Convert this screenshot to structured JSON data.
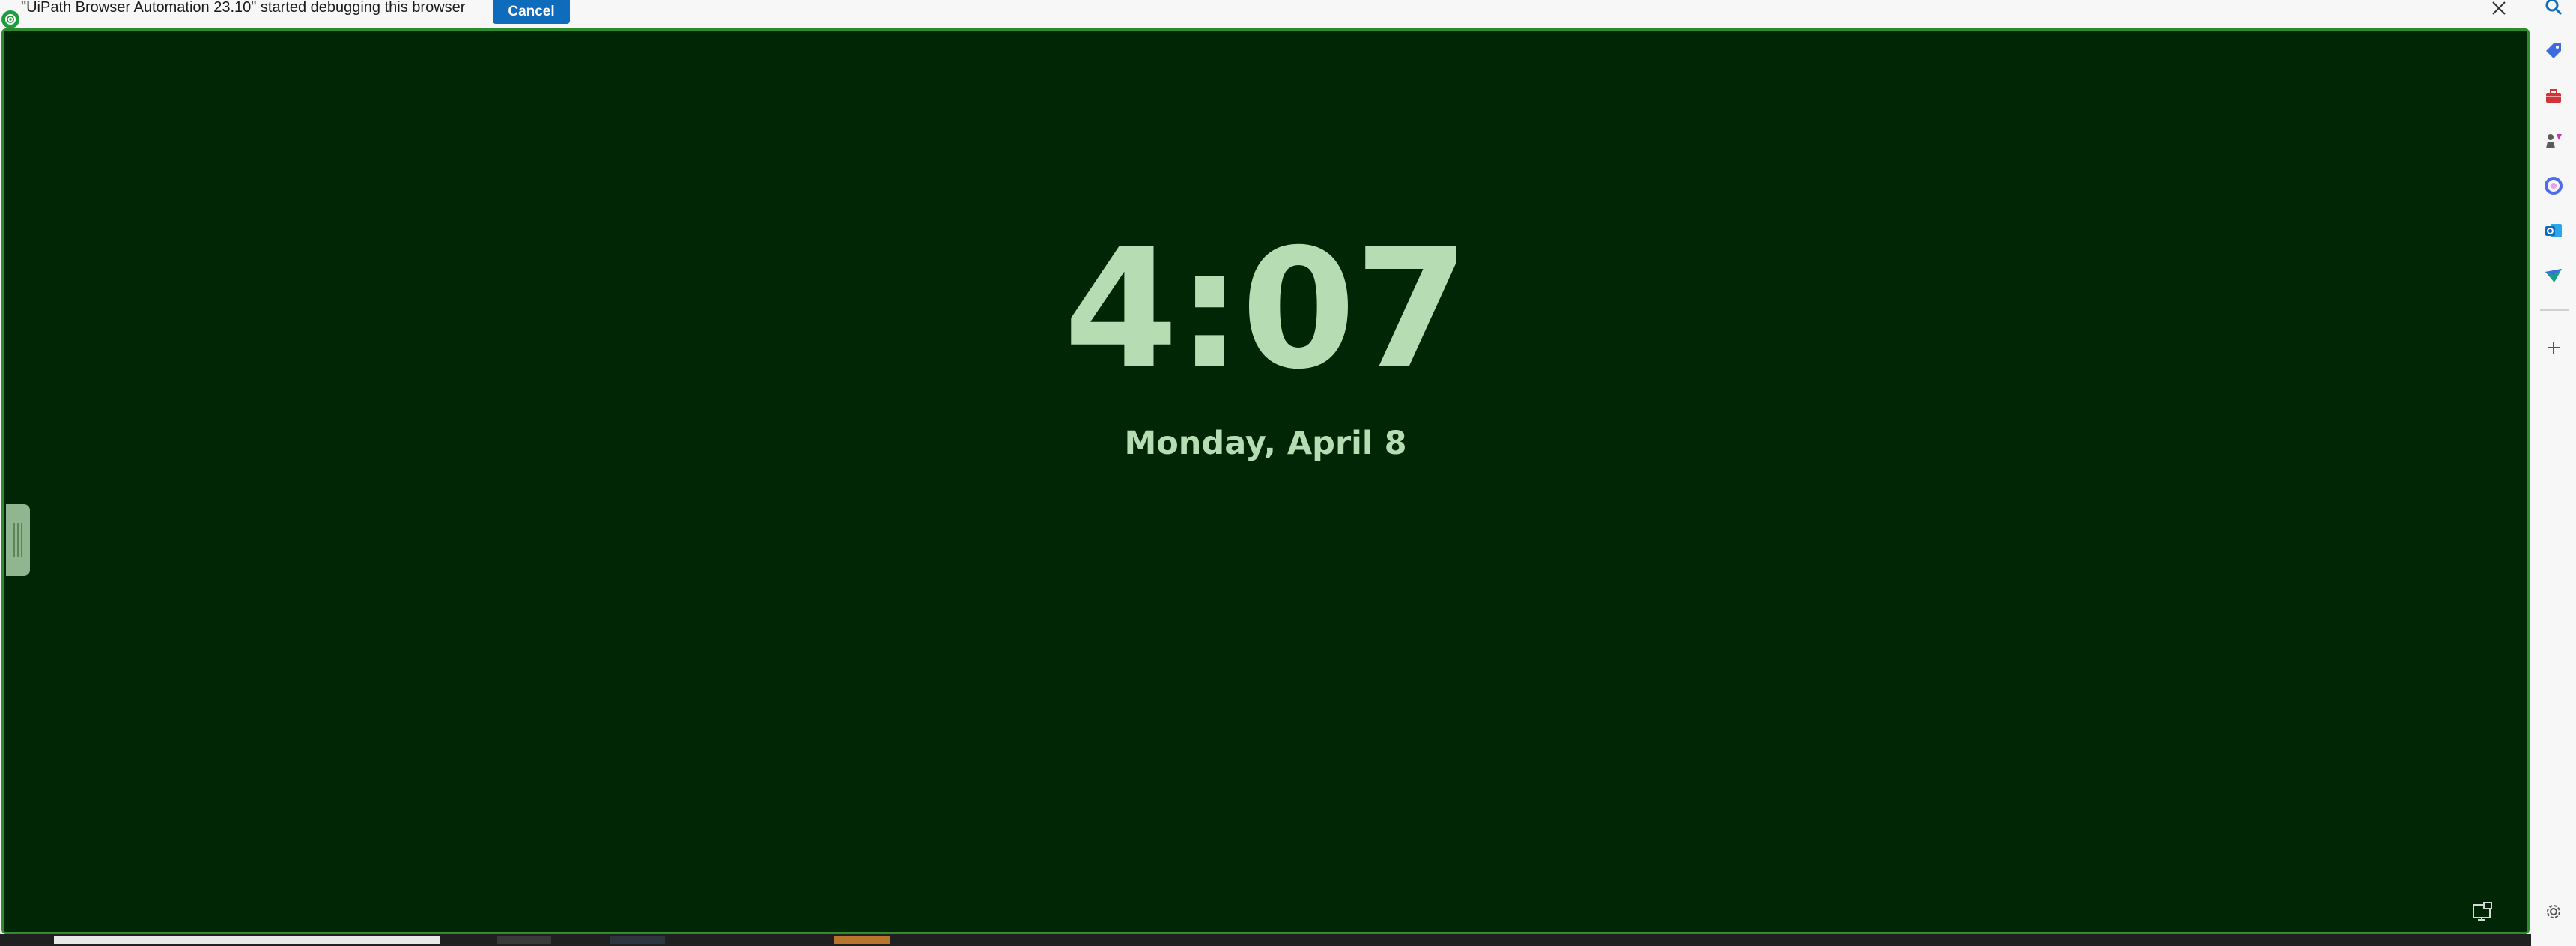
{
  "infobar": {
    "message": "\"UiPath Browser Automation 23.10\" started debugging this browser",
    "cancel_label": "Cancel",
    "icon": "uipath-icon",
    "close_icon": "close-icon"
  },
  "lockscreen": {
    "time": "4:07",
    "date": "Monday, April 8",
    "handle_icon": "drag-handle-icon",
    "pip_icon": "picture-in-picture-icon"
  },
  "sidebar": {
    "items": [
      {
        "name": "search-icon",
        "color": "#0f6cbd"
      },
      {
        "name": "shopping-tag-icon",
        "color": "#3b6de0"
      },
      {
        "name": "tools-icon",
        "color": "#d13438"
      },
      {
        "name": "games-icon",
        "color": "#5b5b5b"
      },
      {
        "name": "copilot-icon",
        "color": "#4f6bed"
      },
      {
        "name": "outlook-icon",
        "color": "#0f6cbd"
      },
      {
        "name": "drop-icon",
        "color": "#16a085"
      },
      {
        "name": "add-icon",
        "color": "#555555"
      },
      {
        "name": "settings-icon",
        "color": "#555555"
      }
    ]
  },
  "colors": {
    "background": "#002605",
    "border": "#2e8b2e",
    "clock_text": "#b6dcb4",
    "cancel_button": "#0f6cbd"
  }
}
